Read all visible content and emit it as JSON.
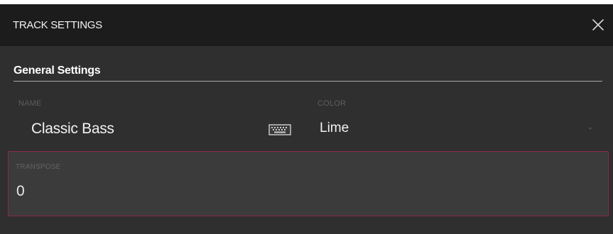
{
  "dialog": {
    "title": "TRACK SETTINGS",
    "close_icon": "close-icon"
  },
  "general_settings": {
    "heading": "General Settings",
    "name": {
      "label": "NAME",
      "value": "Classic Bass",
      "keyboard_icon": "keyboard-icon"
    },
    "color": {
      "label": "COLOR",
      "value": "Lime",
      "caret_icon": "chevron-down-icon"
    },
    "transpose": {
      "label": "TRANSPOSE",
      "value": "0"
    }
  },
  "colors": {
    "title_bar": "#1c1c1c",
    "panel": "#2f2f2f",
    "selected_field_border": "#8a2a45",
    "selected_field_bg": "#3b3b3b",
    "text": "#f2f2f2",
    "label": "#5e5e5e"
  }
}
